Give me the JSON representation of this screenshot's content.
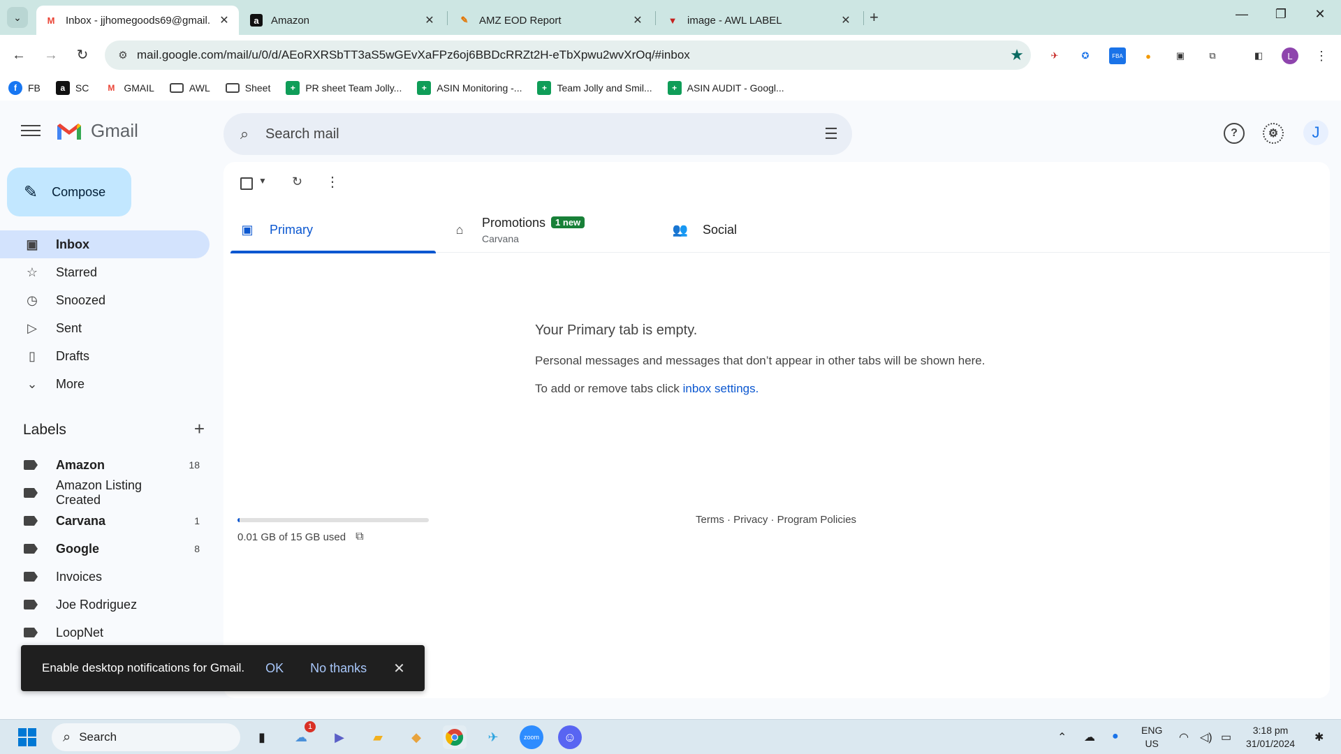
{
  "browser": {
    "tabs": [
      {
        "title": "Inbox - jjhomegoods69@gmail.",
        "icon": "gmail-icon",
        "active": true
      },
      {
        "title": "Amazon",
        "icon": "amazon-icon",
        "active": false
      },
      {
        "title": "AMZ EOD Report",
        "icon": "report-icon",
        "active": false
      },
      {
        "title": "image - AWL LABEL",
        "icon": "awl-icon",
        "active": false
      }
    ],
    "url": "mail.google.com/mail/u/0/d/AEoRXRSbTT3aS5wGEvXaFPz6oj6BBDcRRZt2H-eTbXpwu2wvXrOq/#inbox",
    "profile_initial": "L",
    "bookmarks": [
      {
        "label": "FB",
        "icon": "facebook-icon"
      },
      {
        "label": "SC",
        "icon": "amazon-icon"
      },
      {
        "label": "GMAIL",
        "icon": "gmail-icon"
      },
      {
        "label": "AWL",
        "icon": "folder-icon"
      },
      {
        "label": "Sheet",
        "icon": "folder-icon"
      },
      {
        "label": "PR sheet Team Jolly...",
        "icon": "sheets-icon"
      },
      {
        "label": "ASIN Monitoring -...",
        "icon": "sheets-icon"
      },
      {
        "label": "Team Jolly and Smil...",
        "icon": "sheets-icon"
      },
      {
        "label": "ASIN AUDIT - Googl...",
        "icon": "sheets-icon"
      }
    ]
  },
  "gmail": {
    "wordmark": "Gmail",
    "search_placeholder": "Search mail",
    "avatar_initial": "J",
    "compose_label": "Compose",
    "nav": [
      {
        "label": "Inbox",
        "icon": "inbox-icon",
        "active": true
      },
      {
        "label": "Starred",
        "icon": "star-icon",
        "active": false
      },
      {
        "label": "Snoozed",
        "icon": "clock-icon",
        "active": false
      },
      {
        "label": "Sent",
        "icon": "send-icon",
        "active": false
      },
      {
        "label": "Drafts",
        "icon": "draft-icon",
        "active": false
      },
      {
        "label": "More",
        "icon": "chevron-down-icon",
        "active": false
      }
    ],
    "labels_title": "Labels",
    "labels": [
      {
        "name": "Amazon",
        "count": "18",
        "bold": true
      },
      {
        "name": "Amazon Listing Created",
        "count": "",
        "bold": false
      },
      {
        "name": "Carvana",
        "count": "1",
        "bold": true
      },
      {
        "name": "Google",
        "count": "8",
        "bold": true
      },
      {
        "name": "Invoices",
        "count": "",
        "bold": false
      },
      {
        "name": "Joe Rodriguez",
        "count": "",
        "bold": false
      },
      {
        "name": "LoopNet",
        "count": "",
        "bold": false
      }
    ],
    "tabs": {
      "primary": "Primary",
      "promotions": "Promotions",
      "promotions_badge": "1 new",
      "promotions_sub": "Carvana",
      "social": "Social"
    },
    "empty": {
      "heading": "Your Primary tab is empty.",
      "line1": "Personal messages and messages that don’t appear in other tabs will be shown here.",
      "line2_prefix": "To add or remove tabs click ",
      "line2_link": "inbox settings",
      "line2_suffix": "."
    },
    "storage": {
      "text": "0.01 GB of 15 GB used",
      "used_fraction": 0.001
    },
    "footer": "Terms · Privacy · Program Policies",
    "toast": {
      "message": "Enable desktop notifications for Gmail.",
      "ok": "OK",
      "no_thanks": "No thanks"
    }
  },
  "taskbar": {
    "search_label": "Search",
    "notification_count": "1",
    "lang_line1": "ENG",
    "lang_line2": "US",
    "time": "3:18 pm",
    "date": "31/01/2024"
  }
}
